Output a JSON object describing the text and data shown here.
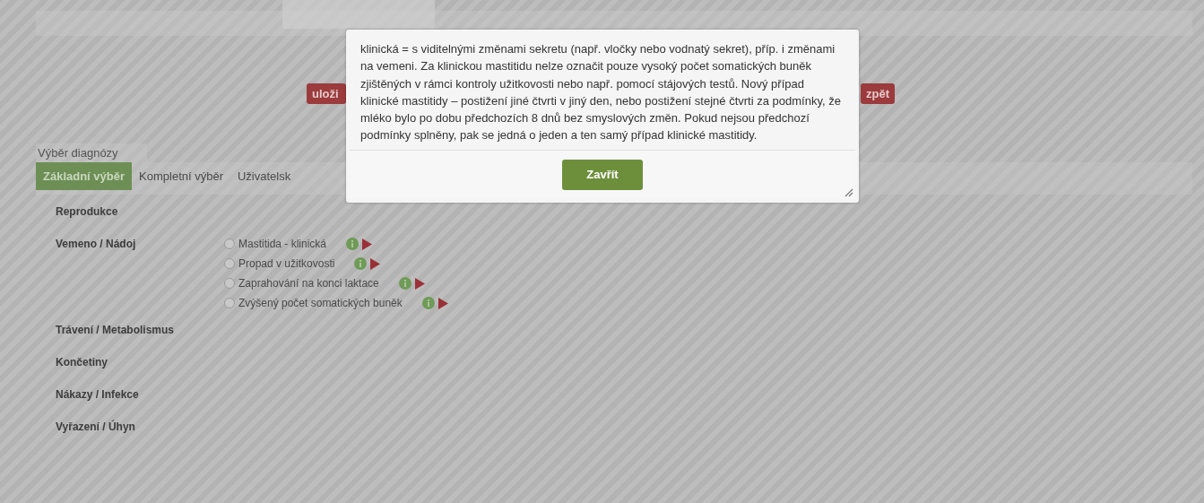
{
  "buttons": [
    {
      "label": "uloži",
      "kind": "save"
    },
    {
      "label": "zpět",
      "kind": "back"
    }
  ],
  "section_title": "Výběr diagnózy",
  "tabs": [
    {
      "label": "Základní výběr",
      "selected": true
    },
    {
      "label": "Kompletní výběr",
      "selected": false
    },
    {
      "label": "Uživatelsk",
      "selected": false
    }
  ],
  "categories": [
    {
      "name": "Reprodukce"
    },
    {
      "name": "Vemeno / Nádoj",
      "options": [
        {
          "label": "Mastitida - klinická",
          "selected": false
        },
        {
          "label": "Propad v užitkovosti",
          "selected": false
        },
        {
          "label": "Zaprahování na konci laktace",
          "selected": false
        },
        {
          "label": "Zvýšený počet somatických buněk",
          "selected": false
        }
      ]
    },
    {
      "name": "Trávení / Metabolismus"
    },
    {
      "name": "Končetiny"
    },
    {
      "name": "Nákazy / Infekce"
    },
    {
      "name": "Vyřazení / Úhyn"
    }
  ],
  "dialog": {
    "text": "klinická = s viditelnými změnami sekretu (např. vločky nebo vodnatý sekret), příp. i změnami na vemeni. Za klinickou mastitidu nelze označit pouze vysoký počet somatických buněk zjištěných v rámci kontroly užitkovosti nebo např. pomocí stájových testů. Nový případ klinické mastitidy – postižení jiné čtvrti v jiný den, nebo postižení stejné čtvrti za podmínky, že mléko bylo po dobu předchozích 8 dnů bez smyslových změn. Pokud nejsou předchozí podmínky splněny, pak se jedná o jeden a ten samý případ klinické mastitidy.",
    "button": "Zavřít"
  }
}
